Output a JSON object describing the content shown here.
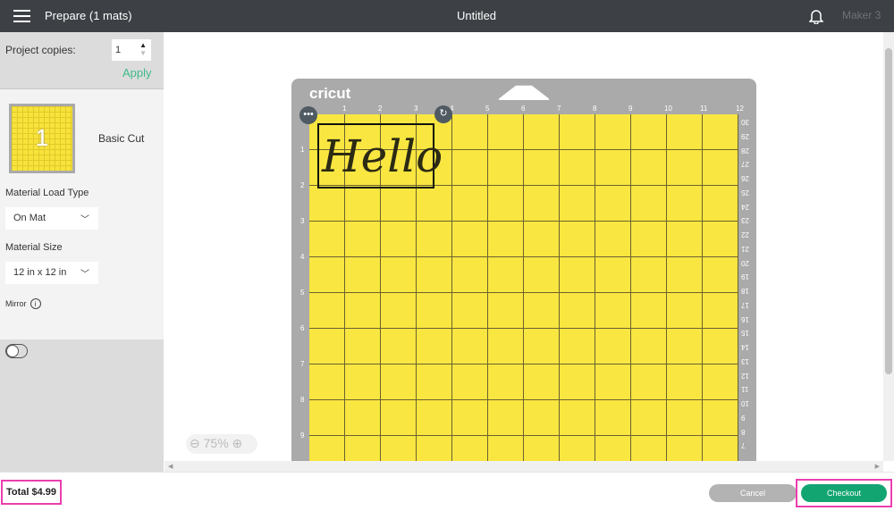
{
  "header": {
    "title": "Prepare (1 mats)",
    "document": "Untitled",
    "machine": "Maker 3",
    "menu_icon": "hamburger-icon",
    "notification_icon": "bell-icon"
  },
  "sidebar": {
    "copies_label": "Project copies:",
    "copies_value": "1",
    "apply_label": "Apply",
    "mat": {
      "number": "1",
      "label": "Basic Cut"
    },
    "load_type_label": "Material Load Type",
    "load_type_value": "On Mat",
    "size_label": "Material Size",
    "size_value": "12 in x 12 in",
    "mirror_label": "Mirror",
    "mirror_on": false
  },
  "mat": {
    "brand": "cricut",
    "color": "#f9e640",
    "design_text": "Hello",
    "column_labels": [
      "1",
      "2",
      "3",
      "4",
      "5",
      "6",
      "7",
      "8",
      "9",
      "10",
      "11",
      "12"
    ],
    "row_labels": [
      "1",
      "2",
      "3",
      "4",
      "5",
      "6",
      "7",
      "8",
      "9"
    ],
    "cm_labels": [
      "30",
      "29",
      "28",
      "27",
      "26",
      "25",
      "24",
      "23",
      "22",
      "21",
      "20",
      "19",
      "18",
      "17",
      "16",
      "15",
      "14",
      "13",
      "12",
      "11",
      "10",
      "9",
      "8",
      "7"
    ]
  },
  "zoom": {
    "level": "75%"
  },
  "footer": {
    "total": "Total $4.99",
    "cancel": "Cancel",
    "checkout": "Checkout",
    "accent": "#13a571",
    "highlight": "#ea3fae"
  }
}
